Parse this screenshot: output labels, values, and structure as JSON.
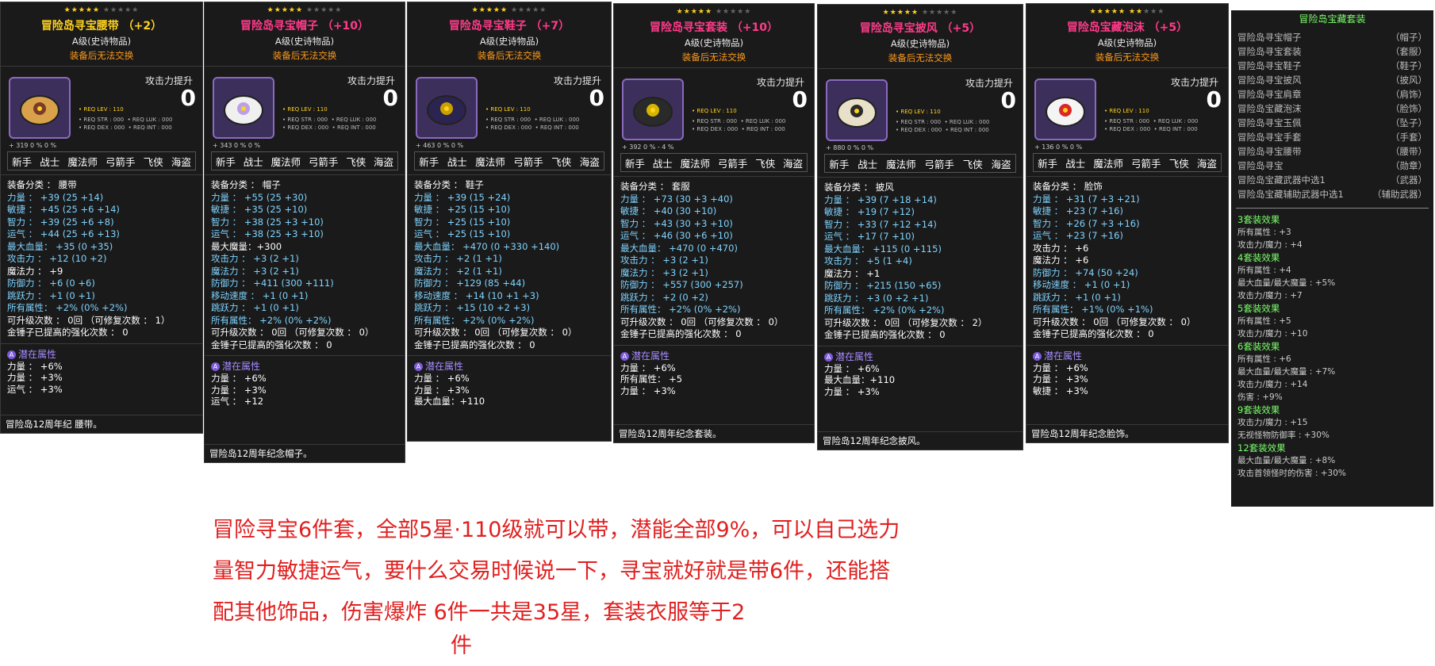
{
  "cards": [
    {
      "stars": 5,
      "title": "冒险岛寻宝腰带 （+2）",
      "title_color": "#ffd21f",
      "grade": "A级(史诗物品)",
      "trade": "装备后无法交换",
      "atk_label": "攻击力提升",
      "atk_value": "0",
      "req_lev": "• REQ LEV : 110",
      "req_stats": "• REQ STR : 000  • REQ LUK : 000\n• REQ DEX : 000  • REQ INT : 000",
      "mini": "+ 319   0 %      0 %",
      "jobs": [
        "新手",
        "战士",
        "魔法师",
        "弓箭手",
        "飞侠",
        "海盗"
      ],
      "stats": [
        {
          "t": "装备分类 ： 腰带",
          "c": "c-white"
        },
        {
          "t": "力量 ： +39 (25 +14)",
          "c": "c-blue"
        },
        {
          "t": "敏捷 ： +45 (25 +6 +14)",
          "c": "c-blue"
        },
        {
          "t": "智力 ： +39 (25 +6 +8)",
          "c": "c-blue"
        },
        {
          "t": "运气 ： +44 (25 +6 +13)",
          "c": "c-blue"
        },
        {
          "t": "最大血量： +35 (0 +35)",
          "c": "c-blue"
        },
        {
          "t": "攻击力 ： +12 (10 +2)",
          "c": "c-blue"
        },
        {
          "t": "魔法力 ： +9",
          "c": "c-white"
        },
        {
          "t": "防御力 ： +6 (0 +6)",
          "c": "c-blue"
        },
        {
          "t": "跳跃力 ： +1 (0 +1)",
          "c": "c-blue"
        },
        {
          "t": "所有属性： +2% (0% +2%)",
          "c": "c-blue"
        },
        {
          "t": "可升级次数 ： 0回 （可修复次数 ： 1）",
          "c": "c-white"
        },
        {
          "t": "金锤子已提高的强化次数 ： 0",
          "c": "c-white"
        }
      ],
      "pot_title": "潜在属性",
      "pot": [
        "力量 ： +6%",
        "力量 ： +3%",
        "运气 ： +3%"
      ],
      "footer": "冒险岛12周年纪 腰带。"
    },
    {
      "stars": 5,
      "title": "冒险岛寻宝帽子 （+10）",
      "title_color": "#ff3b8a",
      "grade": "A级(史诗物品)",
      "trade": "装备后无法交换",
      "atk_label": "攻击力提升",
      "atk_value": "0",
      "req_lev": "• REQ LEV : 110",
      "req_stats": "• REQ STR : 000  • REQ LUK : 000\n• REQ DEX : 000  • REQ INT : 000",
      "mini": "+ 343   0 %      0 %",
      "jobs": [
        "新手",
        "战士",
        "魔法师",
        "弓箭手",
        "飞侠",
        "海盗"
      ],
      "stats": [
        {
          "t": "装备分类 ： 帽子",
          "c": "c-white"
        },
        {
          "t": "力量 ： +55 (25 +30)",
          "c": "c-blue"
        },
        {
          "t": "敏捷 ： +35 (25 +10)",
          "c": "c-blue"
        },
        {
          "t": "智力 ： +38 (25 +3 +10)",
          "c": "c-blue"
        },
        {
          "t": "运气 ： +38 (25 +3 +10)",
          "c": "c-blue"
        },
        {
          "t": "最大魔量：+300",
          "c": "c-white"
        },
        {
          "t": "攻击力 ： +3 (2 +1)",
          "c": "c-blue"
        },
        {
          "t": "魔法力 ： +3 (2 +1)",
          "c": "c-blue"
        },
        {
          "t": "防御力 ： +411 (300 +111)",
          "c": "c-blue"
        },
        {
          "t": "移动速度 ： +1 (0 +1)",
          "c": "c-blue"
        },
        {
          "t": "跳跃力 ： +1 (0 +1)",
          "c": "c-blue"
        },
        {
          "t": "所有属性： +2% (0% +2%)",
          "c": "c-blue"
        },
        {
          "t": "可升级次数 ： 0回 （可修复次数 ： 0）",
          "c": "c-white"
        },
        {
          "t": "金锤子已提高的强化次数 ： 0",
          "c": "c-white"
        }
      ],
      "pot_title": "潜在属性",
      "pot": [
        "力量 ： +6%",
        "力量 ： +3%",
        "运气 ： +12"
      ],
      "footer": "冒险岛12周年纪念帽子。"
    },
    {
      "stars": 5,
      "title": "冒险岛寻宝鞋子 （+7）",
      "title_color": "#ff3b8a",
      "grade": "A级(史诗物品)",
      "trade": "装备后无法交换",
      "atk_label": "攻击力提升",
      "atk_value": "0",
      "req_lev": "• REQ LEV : 110",
      "req_stats": "• REQ STR : 000  • REQ LUK : 000\n• REQ DEX : 000  • REQ INT : 000",
      "mini": "+ 463   0 %      0 %",
      "jobs": [
        "新手",
        "战士",
        "魔法师",
        "弓箭手",
        "飞侠",
        "海盗"
      ],
      "stats": [
        {
          "t": "装备分类 ： 鞋子",
          "c": "c-white"
        },
        {
          "t": "力量 ： +39 (15 +24)",
          "c": "c-blue"
        },
        {
          "t": "敏捷 ： +25 (15 +10)",
          "c": "c-blue"
        },
        {
          "t": "智力 ： +25 (15 +10)",
          "c": "c-blue"
        },
        {
          "t": "运气 ： +25 (15 +10)",
          "c": "c-blue"
        },
        {
          "t": "最大血量： +470 (0 +330 +140)",
          "c": "c-blue"
        },
        {
          "t": "攻击力 ： +2 (1 +1)",
          "c": "c-blue"
        },
        {
          "t": "魔法力 ： +2 (1 +1)",
          "c": "c-blue"
        },
        {
          "t": "防御力 ： +129 (85 +44)",
          "c": "c-blue"
        },
        {
          "t": "移动速度 ： +14 (10 +1 +3)",
          "c": "c-blue"
        },
        {
          "t": "跳跃力 ： +15 (10 +2 +3)",
          "c": "c-blue"
        },
        {
          "t": "所有属性： +2% (0% +2%)",
          "c": "c-blue"
        },
        {
          "t": "可升级次数 ： 0回 （可修复次数 ： 0）",
          "c": "c-white"
        },
        {
          "t": "金锤子已提高的强化次数 ： 0",
          "c": "c-white"
        }
      ],
      "pot_title": "潜在属性",
      "pot": [
        "力量 ： +6%",
        "力量 ： +3%",
        "最大血量：+110"
      ],
      "footer": ""
    },
    {
      "stars": 5,
      "title": "冒险岛寻宝套装 （+10）",
      "title_color": "#ff3b8a",
      "grade": "A级(史诗物品)",
      "trade": "装备后无法交换",
      "atk_label": "攻击力提升",
      "atk_value": "0",
      "req_lev": "• REQ LEV : 110",
      "req_stats": "• REQ STR : 000  • REQ LUK : 000\n• REQ DEX : 000  • REQ INT : 000",
      "mini": "+ 392   0 %      - 4 %",
      "jobs": [
        "新手",
        "战士",
        "魔法师",
        "弓箭手",
        "飞侠",
        "海盗"
      ],
      "stats": [
        {
          "t": "装备分类 ： 套服",
          "c": "c-white"
        },
        {
          "t": "力量 ： +73 (30 +3 +40)",
          "c": "c-blue"
        },
        {
          "t": "敏捷 ： +40 (30 +10)",
          "c": "c-blue"
        },
        {
          "t": "智力 ： +43 (30 +3 +10)",
          "c": "c-blue"
        },
        {
          "t": "运气 ： +46 (30 +6 +10)",
          "c": "c-blue"
        },
        {
          "t": "最大血量： +470 (0 +470)",
          "c": "c-blue"
        },
        {
          "t": "攻击力 ： +3 (2 +1)",
          "c": "c-blue"
        },
        {
          "t": "魔法力 ： +3 (2 +1)",
          "c": "c-blue"
        },
        {
          "t": "防御力 ： +557 (300 +257)",
          "c": "c-blue"
        },
        {
          "t": "跳跃力 ： +2 (0 +2)",
          "c": "c-blue"
        },
        {
          "t": "所有属性： +2% (0% +2%)",
          "c": "c-blue"
        },
        {
          "t": "可升级次数 ： 0回 （可修复次数 ： 0）",
          "c": "c-white"
        },
        {
          "t": "金锤子已提高的强化次数 ： 0",
          "c": "c-white"
        }
      ],
      "pot_title": "潜在属性",
      "pot": [
        "力量 ： +6%",
        "所有属性： +5",
        "力量 ： +3%"
      ],
      "footer": "冒险岛12周年纪念套装。"
    },
    {
      "stars": 5,
      "title": "冒险岛寻宝披风 （+5）",
      "title_color": "#ff3b8a",
      "grade": "A级(史诗物品)",
      "trade": "装备后无法交换",
      "atk_label": "攻击力提升",
      "atk_value": "0",
      "req_lev": "• REQ LEV : 110",
      "req_stats": "• REQ STR : 000  • REQ LUK : 000\n• REQ DEX : 000  • REQ INT : 000",
      "mini": "+ 880   0 %      0 %",
      "jobs": [
        "新手",
        "战士",
        "魔法师",
        "弓箭手",
        "飞侠",
        "海盗"
      ],
      "stats": [
        {
          "t": "装备分类 ： 披风",
          "c": "c-white"
        },
        {
          "t": "力量 ： +39 (7 +18 +14)",
          "c": "c-blue"
        },
        {
          "t": "敏捷 ： +19 (7 +12)",
          "c": "c-blue"
        },
        {
          "t": "智力 ： +33 (7 +12 +14)",
          "c": "c-blue"
        },
        {
          "t": "运气 ： +17 (7 +10)",
          "c": "c-blue"
        },
        {
          "t": "最大血量： +115 (0 +115)",
          "c": "c-blue"
        },
        {
          "t": "攻击力 ： +5 (1 +4)",
          "c": "c-blue"
        },
        {
          "t": "魔法力 ： +1",
          "c": "c-white"
        },
        {
          "t": "防御力 ： +215 (150 +65)",
          "c": "c-blue"
        },
        {
          "t": "跳跃力 ： +3 (0 +2 +1)",
          "c": "c-blue"
        },
        {
          "t": "所有属性： +2% (0% +2%)",
          "c": "c-blue"
        },
        {
          "t": "可升级次数 ： 0回 （可修复次数 ： 2）",
          "c": "c-white"
        },
        {
          "t": "金锤子已提高的强化次数 ： 0",
          "c": "c-white"
        }
      ],
      "pot_title": "潜在属性",
      "pot": [
        "力量 ： +6%",
        "最大血量：+110",
        "力量 ： +3%"
      ],
      "footer": "冒险岛12周年纪念披风。"
    },
    {
      "stars": 7,
      "title": "冒险岛宝藏泡沫 （+5）",
      "title_color": "#ff3b8a",
      "grade": "A级(史诗物品)",
      "trade": "装备后无法交换",
      "atk_label": "攻击力提升",
      "atk_value": "0",
      "req_lev": "• REQ LEV : 110",
      "req_stats": "• REQ STR : 000  • REQ LUK : 000\n• REQ DEX : 000  • REQ INT : 000",
      "mini": "+ 136   0 %      0 %",
      "jobs": [
        "新手",
        "战士",
        "魔法师",
        "弓箭手",
        "飞侠",
        "海盗"
      ],
      "stats": [
        {
          "t": "装备分类 ： 脸饰",
          "c": "c-white"
        },
        {
          "t": "力量 ： +31 (7 +3 +21)",
          "c": "c-blue"
        },
        {
          "t": "敏捷 ： +23 (7 +16)",
          "c": "c-blue"
        },
        {
          "t": "智力 ： +26 (7 +3 +16)",
          "c": "c-blue"
        },
        {
          "t": "运气 ： +23 (7 +16)",
          "c": "c-blue"
        },
        {
          "t": "攻击力 ： +6",
          "c": "c-white"
        },
        {
          "t": "魔法力 ： +6",
          "c": "c-white"
        },
        {
          "t": "防御力 ： +74 (50 +24)",
          "c": "c-blue"
        },
        {
          "t": "移动速度 ： +1 (0 +1)",
          "c": "c-blue"
        },
        {
          "t": "跳跃力 ： +1 (0 +1)",
          "c": "c-blue"
        },
        {
          "t": "所有属性： +1% (0% +1%)",
          "c": "c-blue"
        },
        {
          "t": "可升级次数 ： 0回 （可修复次数 ： 0）",
          "c": "c-white"
        },
        {
          "t": "金锤子已提高的强化次数 ： 0",
          "c": "c-white"
        }
      ],
      "pot_title": "潜在属性",
      "pot": [
        "力量 ： +6%",
        "力量 ： +3%",
        "敏捷 ： +3%"
      ],
      "footer": "冒险岛12周年纪念脸饰。"
    }
  ],
  "set_panel": {
    "title": "冒险岛宝藏套装",
    "items": [
      {
        "n": "冒险岛寻宝帽子",
        "t": "（帽子）"
      },
      {
        "n": "冒险岛寻宝套装",
        "t": "（套服）"
      },
      {
        "n": "冒险岛寻宝鞋子",
        "t": "（鞋子）"
      },
      {
        "n": "冒险岛寻宝披风",
        "t": "（披风）"
      },
      {
        "n": "冒险岛寻宝肩章",
        "t": "（肩饰）"
      },
      {
        "n": "冒险岛宝藏泡沫",
        "t": "（脸饰）"
      },
      {
        "n": "冒险岛寻宝玉佩",
        "t": "（坠子）"
      },
      {
        "n": "冒险岛寻宝手套",
        "t": "（手套）"
      },
      {
        "n": "冒险岛寻宝腰带",
        "t": "（腰带）"
      },
      {
        "n": "冒险岛寻宝",
        "t": "（勋章）"
      },
      {
        "n": "冒险岛宝藏武器中选1",
        "t": "（武器）"
      },
      {
        "n": "冒险岛宝藏辅助武器中选1",
        "t": "（辅助武器）"
      }
    ],
    "effects": [
      {
        "h": "3套装效果",
        "lines": [
          "所有属性 : +3",
          "攻击力/魔力 : +4"
        ]
      },
      {
        "h": "4套装效果",
        "lines": [
          "所有属性 : +4",
          "最大血量/最大魔量 : +5%",
          "攻击力/魔力 : +7"
        ]
      },
      {
        "h": "5套装效果",
        "lines": [
          "所有属性 : +5",
          "攻击力/魔力 : +10"
        ]
      },
      {
        "h": "6套装效果",
        "lines": [
          "所有属性 : +6",
          "最大血量/最大魔量 : +7%",
          "攻击力/魔力 : +14",
          "伤害 : +9%"
        ]
      },
      {
        "h": "9套装效果",
        "lines": [
          "攻击力/魔力 : +15",
          "无视怪物防御率 : +30%"
        ]
      },
      {
        "h": "12套装效果",
        "lines": [
          "最大血量/最大魔量 : +8%",
          "攻击首领怪时的伤害 : +30%"
        ]
      }
    ]
  },
  "note": {
    "line1": "冒险寻宝6件套，全部5星·110级就可以带，潜能全部9%，可以自己选力",
    "line2": "量智力敏捷运气，要什么交易时候说一下，寻宝就好就是带6件，还能搭",
    "line3": "配其他饰品，伤害爆炸 6件一共是35星，套装衣服等于2",
    "line4": "件"
  },
  "colors": {
    "note": "#e02020",
    "stat_blue": "#7fd3ff",
    "potential": "#a88bff",
    "set_green": "#7bff6b"
  }
}
